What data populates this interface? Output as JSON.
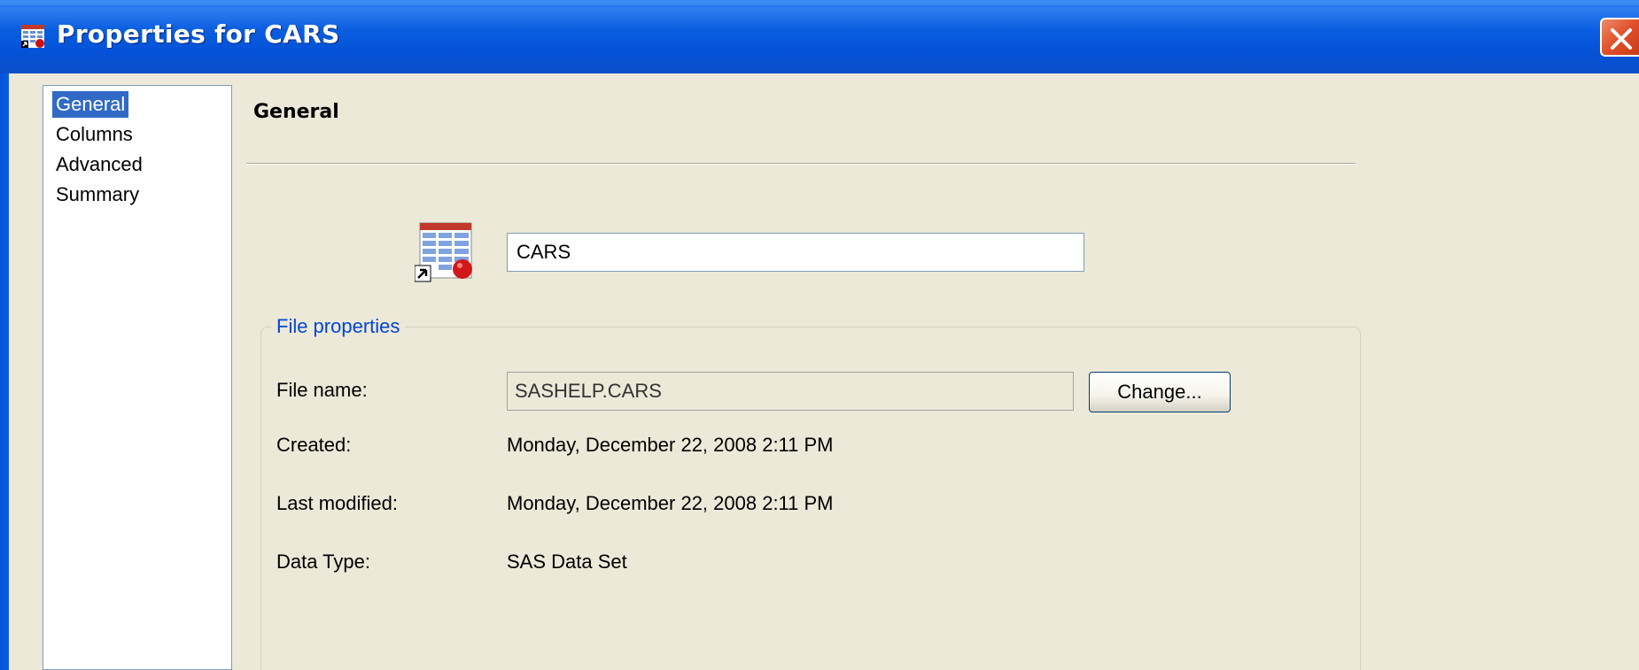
{
  "window": {
    "title": "Properties for CARS",
    "title_icon": "dataset-properties-icon",
    "close_icon": "close-icon",
    "colors": {
      "titlebar": "#0a5fe8",
      "face": "#ece9d8",
      "selection": "#316ac5",
      "groupbox_title": "#0046d5",
      "close": "#e0502a"
    }
  },
  "nav": {
    "items": [
      {
        "label": "General",
        "selected": true
      },
      {
        "label": "Columns",
        "selected": false
      },
      {
        "label": "Advanced",
        "selected": false
      },
      {
        "label": "Summary",
        "selected": false
      }
    ]
  },
  "general": {
    "heading": "General",
    "dataset_icon": "sas-dataset-shortcut-icon",
    "name_value": "CARS",
    "file_properties": {
      "legend": "File properties",
      "file_name_label": "File name:",
      "file_name_value": "SASHELP.CARS",
      "change_button": "Change...",
      "created_label": "Created:",
      "created_value": "Monday, December 22, 2008 2:11 PM",
      "modified_label": "Last modified:",
      "modified_value": "Monday, December 22, 2008 2:11 PM",
      "data_type_label": "Data Type:",
      "data_type_value": "SAS Data Set"
    }
  }
}
